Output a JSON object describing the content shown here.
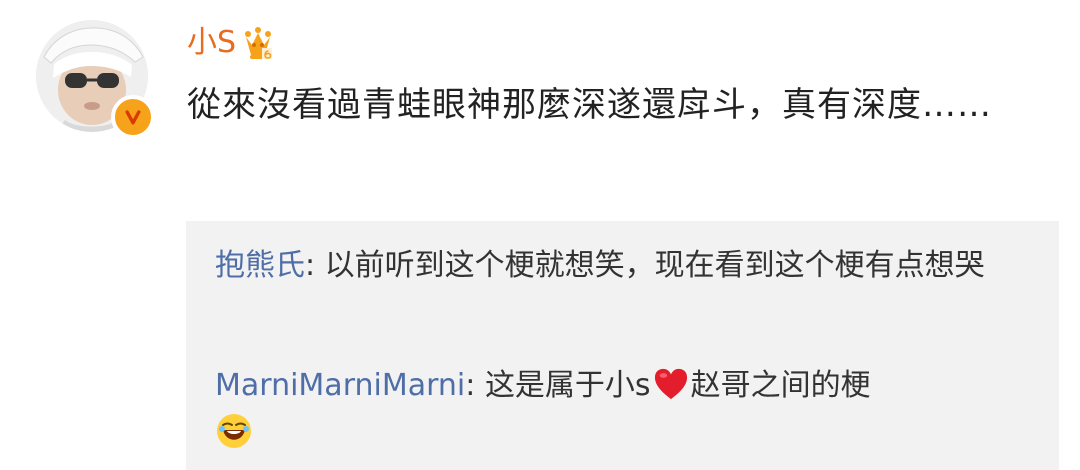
{
  "post": {
    "author_name": "小S",
    "text": "從來沒看過青蛙眼神那麼深遂還戽斗，真有深度……"
  },
  "comments": [
    {
      "author": "抱熊氏",
      "separator": ": ",
      "text": "以前听到这个梗就想笑，现在看到这个梗有点想哭"
    },
    {
      "author": "MarniMarniMarni",
      "separator": ": ",
      "text_before": "这是属于小s",
      "heart_emoji": "heart-emoji",
      "text_after": "赵哥之间的梗",
      "end_emoji": "laughing-emoji"
    }
  ],
  "colors": {
    "author_name": "#e86b1f",
    "comment_author": "#4f6ea8",
    "comment_bg": "#f2f2f2",
    "verified_badge": "#f7a21b"
  }
}
